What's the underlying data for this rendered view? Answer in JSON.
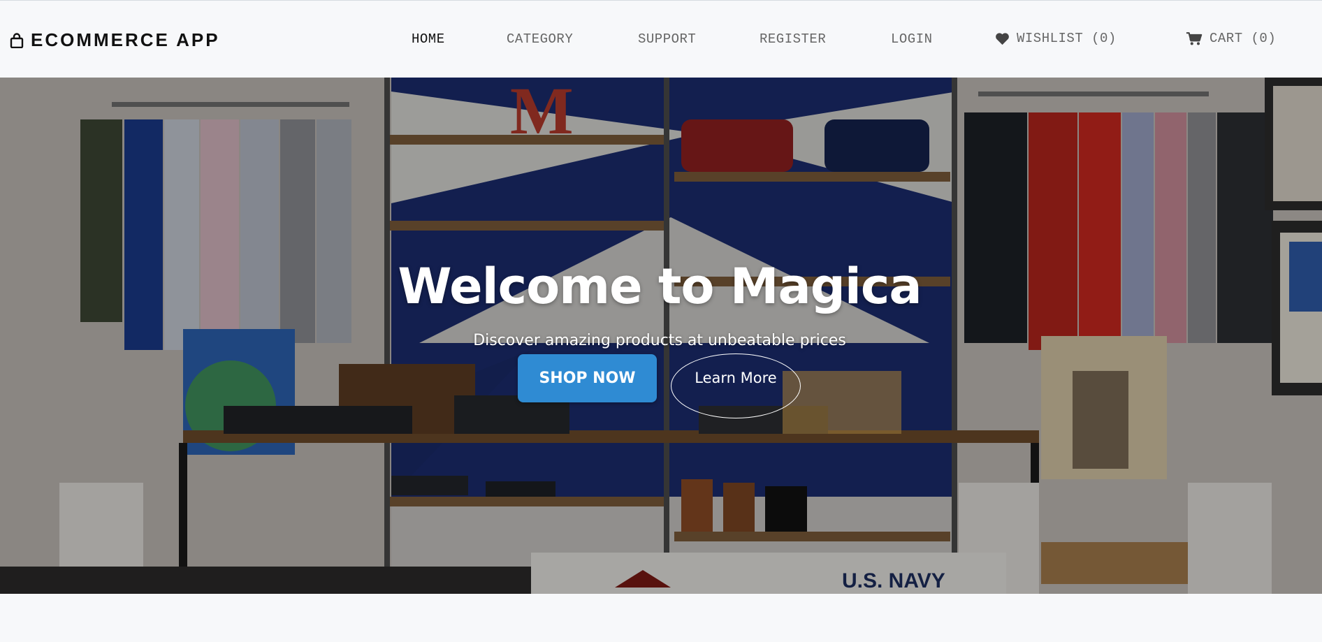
{
  "brand": {
    "icon": "shopping-bag-icon",
    "name": "ECOMMERCE APP"
  },
  "nav": {
    "home": "HOME",
    "category": "CATEGORY",
    "support": "SUPPORT",
    "register": "REGISTER",
    "login": "LOGIN",
    "wishlist": {
      "icon": "heart-icon",
      "label": "WISHLIST (0)"
    },
    "cart": {
      "icon": "cart-icon",
      "label": "CART (0)"
    }
  },
  "hero": {
    "title": "Welcome to Magica",
    "subtitle": "Discover amazing products at unbeatable prices",
    "primary_button": "SHOP NOW",
    "secondary_button": "Learn More",
    "background": "clothing store interior photo"
  },
  "colors": {
    "accent": "#2f8bd3",
    "nav_active": "#111111",
    "nav_text": "#666666",
    "page_bg": "#f7f8fa"
  }
}
